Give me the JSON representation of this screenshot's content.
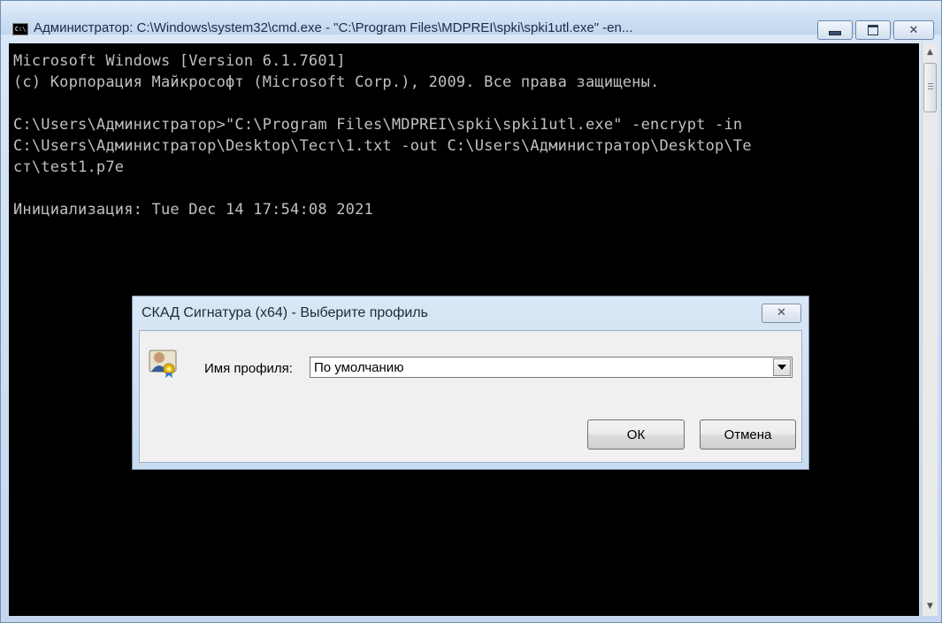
{
  "window": {
    "title": "Администратор: C:\\Windows\\system32\\cmd.exe - \"C:\\Program Files\\MDPREI\\spki\\spki1utl.exe\"  -en...",
    "icon": "cmd-icon",
    "icon_text": "C:\\",
    "min_icon": "minimize-icon",
    "max_icon": "maximize-icon",
    "close_glyph": "✕"
  },
  "console": {
    "lines": [
      "Microsoft Windows [Version 6.1.7601]",
      "(c) Корпорация Майкрософт (Microsoft Corp.), 2009. Все права защищены.",
      "",
      "C:\\Users\\Администратор>\"C:\\Program Files\\MDPREI\\spki\\spki1utl.exe\" -encrypt -in",
      "C:\\Users\\Администратор\\Desktop\\Тест\\1.txt -out C:\\Users\\Администратор\\Desktop\\Те",
      "ст\\test1.p7e",
      "",
      "Инициализация: Tue Dec 14 17:54:08 2021"
    ],
    "scroll_up": "▲",
    "scroll_down": "▼"
  },
  "dialog": {
    "title": "СКАД Сигнатура (x64) - Выберите профиль",
    "close_glyph": "✕",
    "profile_label": "Имя профиля:",
    "profile_value": "По умолчанию",
    "ok_label": "ОК",
    "cancel_label": "Отмена"
  }
}
